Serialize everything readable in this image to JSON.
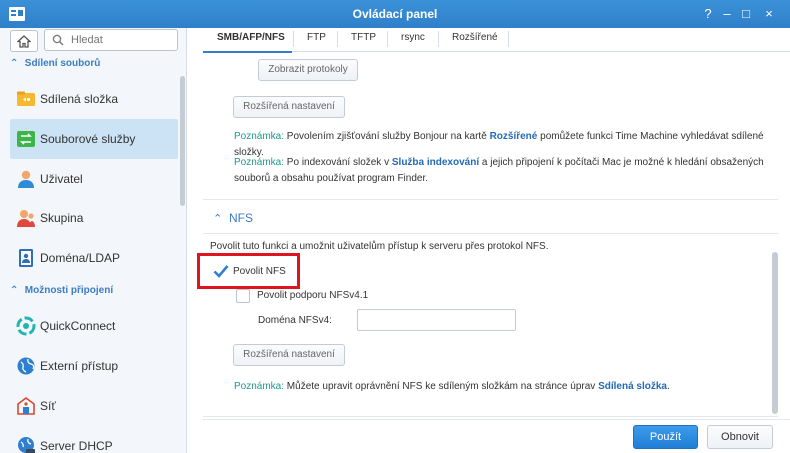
{
  "window": {
    "title": "Ovládací panel",
    "controls": [
      "?",
      "–",
      "□",
      "×"
    ]
  },
  "sidebar": {
    "search_placeholder": "Hledat",
    "sections": [
      {
        "label": "Sdílení souborů",
        "items": [
          {
            "label": "Sdílená složka",
            "icon": "shared-folder-icon",
            "active": false
          },
          {
            "label": "Souborové služby",
            "icon": "file-services-icon",
            "active": true
          },
          {
            "label": "Uživatel",
            "icon": "user-icon",
            "active": false
          },
          {
            "label": "Skupina",
            "icon": "group-icon",
            "active": false
          },
          {
            "label": "Doména/LDAP",
            "icon": "domain-ldap-icon",
            "active": false
          }
        ]
      },
      {
        "label": "Možnosti připojení",
        "items": [
          {
            "label": "QuickConnect",
            "icon": "quickconnect-icon",
            "active": false
          },
          {
            "label": "Externí přístup",
            "icon": "external-access-icon",
            "active": false
          },
          {
            "label": "Síť",
            "icon": "network-icon",
            "active": false
          },
          {
            "label": "Server DHCP",
            "icon": "dhcp-server-icon",
            "active": false
          }
        ]
      }
    ]
  },
  "tabs": [
    {
      "label": "SMB/AFP/NFS",
      "active": true
    },
    {
      "label": "FTP",
      "active": false
    },
    {
      "label": "TFTP",
      "active": false
    },
    {
      "label": "rsync",
      "active": false
    },
    {
      "label": "Rozšířené",
      "active": false
    }
  ],
  "afp": {
    "show_logs_button": "Zobrazit protokoly",
    "advanced_button": "Rozšířená nastavení",
    "note1": {
      "label": "Poznámka:",
      "text_before": " Povolením zjišťování služby Bonjour na kartě ",
      "link": "Rozšířené",
      "text_after": " pomůžete funkci Time Machine vyhledávat sdílené složky."
    },
    "note2": {
      "label": "Poznámka:",
      "text_before": " Po indexování složek v ",
      "link": "Služba indexování",
      "text_after_line1": " a jejich připojení k počítači Mac je možné k hledání obsažených",
      "text_line2": "souborů a obsahu používat program Finder."
    }
  },
  "nfs": {
    "section_title": "NFS",
    "description": "Povolit tuto funkci a umožnit uživatelům přístup k serveru přes protokol NFS.",
    "enable_label": "Povolit NFS",
    "enable_checked": true,
    "nfsv41_label": "Povolit podporu NFSv4.1",
    "nfsv41_checked": false,
    "domain_label": "Doména NFSv4:",
    "domain_value": "",
    "advanced_button": "Rozšířená nastavení",
    "note": {
      "label": "Poznámka:",
      "text_before": " Můžete upravit oprávnění NFS ke sdíleným složkám na stránce úprav ",
      "link": "Sdílená složka",
      "text_after": "."
    }
  },
  "footer": {
    "apply_button": "Použít",
    "reset_button": "Obnovit"
  },
  "colors": {
    "accent": "#2f80c9",
    "active_item": "#cce3f5",
    "note_label": "#1e9a8a",
    "highlight": "#e0141f"
  }
}
